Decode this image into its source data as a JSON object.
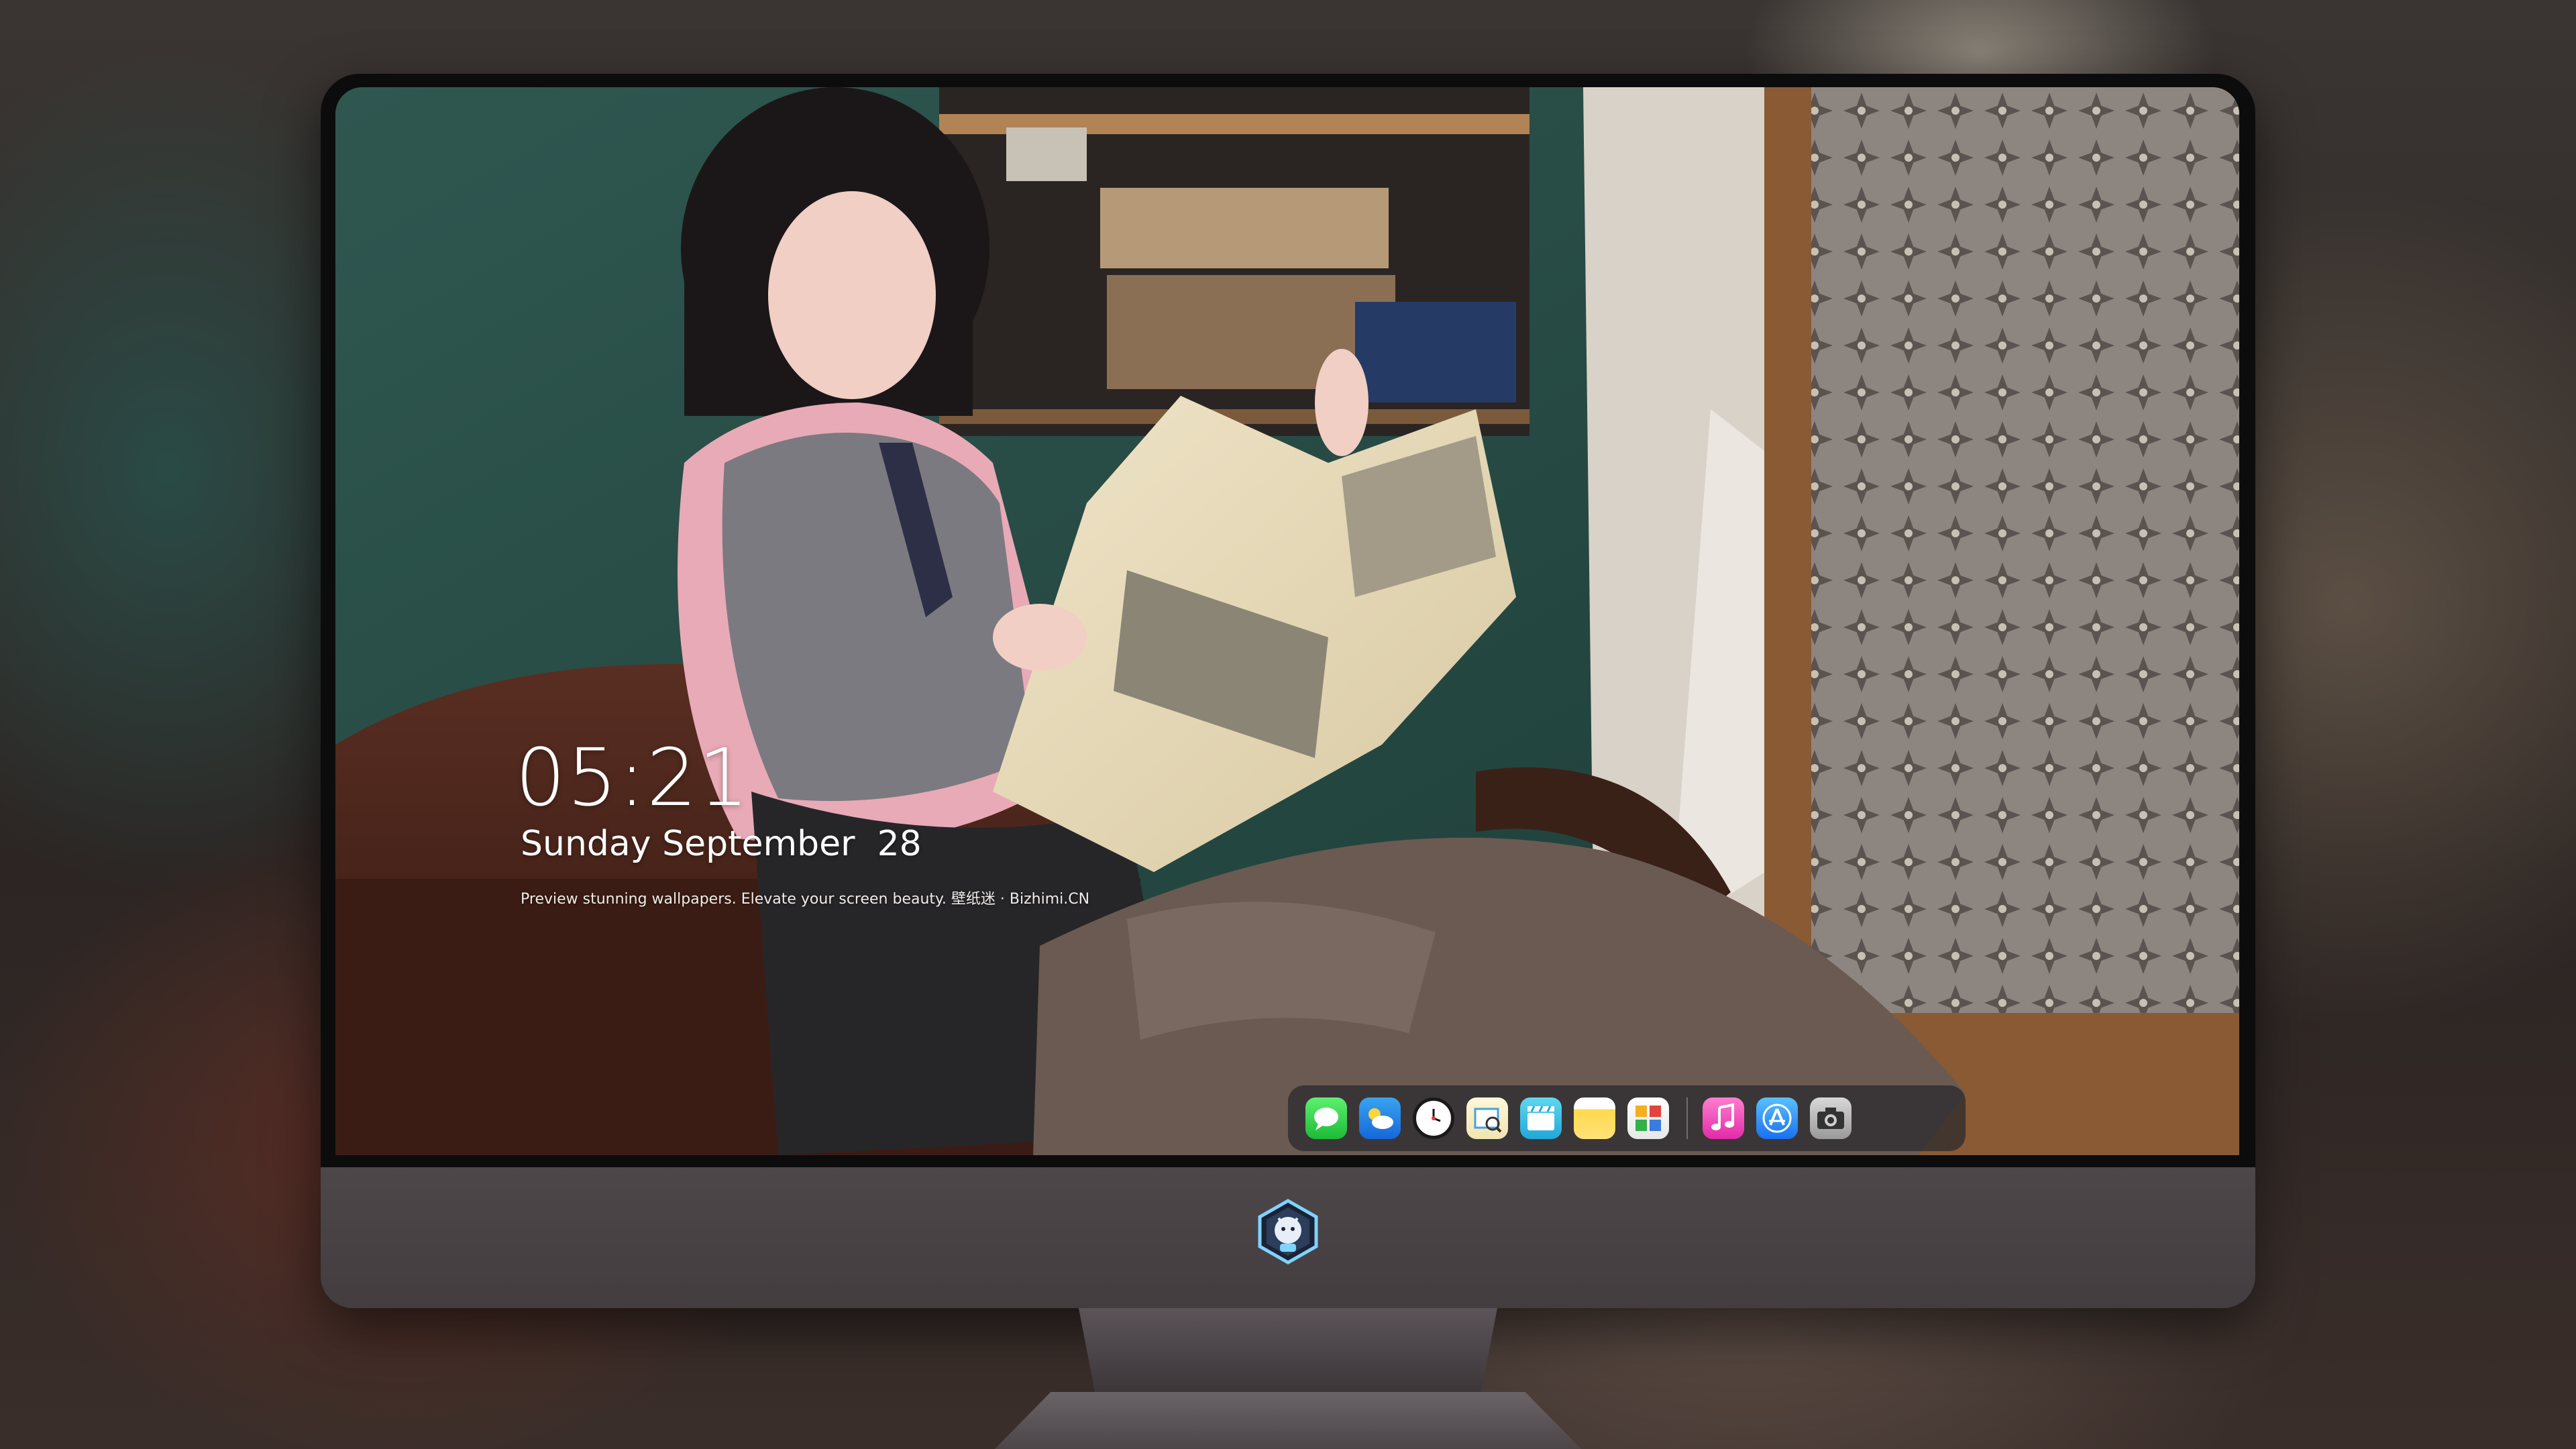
{
  "lock_screen": {
    "time": "05:21",
    "date": "Sunday September  28",
    "tagline": "Preview stunning wallpapers. Elevate your screen beauty. 壁纸迷 · Bizhimi.CN"
  },
  "dock": {
    "apps": [
      {
        "name": "Messages",
        "icon": "messages-icon"
      },
      {
        "name": "Weather",
        "icon": "weather-icon"
      },
      {
        "name": "Clock",
        "icon": "clock-icon"
      },
      {
        "name": "Preview",
        "icon": "preview-icon"
      },
      {
        "name": "Clips",
        "icon": "clips-icon"
      },
      {
        "name": "Notes",
        "icon": "notes-icon"
      },
      {
        "name": "Photos",
        "icon": "photos-icon"
      },
      {
        "name": "Music",
        "icon": "music-icon"
      },
      {
        "name": "App Store",
        "icon": "app-store-icon"
      },
      {
        "name": "Camera",
        "icon": "camera-icon"
      }
    ]
  },
  "colors": {
    "bezel": "#0c0c0d",
    "chin": "#4a4447",
    "dock_bg": "rgba(40,40,44,0.72)"
  }
}
